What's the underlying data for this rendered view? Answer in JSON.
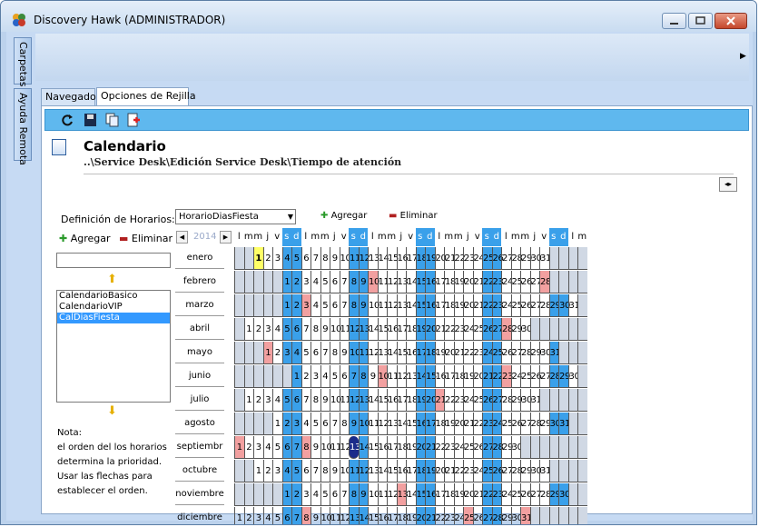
{
  "window": {
    "title": "Discovery Hawk (ADMINISTRADOR)"
  },
  "vertical_tabs": [
    "Carpetas",
    "Ayuda Remota"
  ],
  "tabs": [
    "Navegador",
    "Opciones de Rejilla"
  ],
  "toolbar": {
    "icons": [
      "refresh-icon",
      "save-icon",
      "copy-icon",
      "new-document-icon"
    ]
  },
  "header": {
    "title": "Calendario",
    "breadcrumb": "..\\Service Desk\\Edición Service Desk\\Tiempo de atención"
  },
  "left": {
    "definition_label": "Definición de Horarios:",
    "add_label": "Agregar",
    "delete_label": "Eliminar",
    "input_value": "",
    "items": [
      "CalendarioBasico",
      "CalendarioVIP",
      "CalDiasFiesta"
    ],
    "selected_index": 2,
    "note": [
      "Nota:",
      "el orden del los horarios",
      "determina la prioridad.",
      "Usar las flechas para",
      "establecer el orden."
    ]
  },
  "grid": {
    "combo_value": "HorarioDiasFiesta",
    "add_label": "Agregar",
    "delete_label": "Eliminar",
    "year": "2014",
    "weekday_headers": [
      "l",
      "m",
      "m",
      "j",
      "v",
      "s",
      "d",
      "l",
      "m",
      "m",
      "j",
      "v",
      "s",
      "d",
      "l",
      "m",
      "m",
      "j",
      "v",
      "s",
      "d",
      "l",
      "m",
      "m",
      "j",
      "v",
      "s",
      "d",
      "l",
      "m",
      "m",
      "j",
      "v",
      "s",
      "d",
      "l",
      "m"
    ],
    "months": [
      {
        "name": "enero",
        "offset": 2,
        "days": 31,
        "holidays": [],
        "today": 1
      },
      {
        "name": "febrero",
        "offset": 5,
        "days": 28,
        "holidays": [
          10,
          28
        ]
      },
      {
        "name": "marzo",
        "offset": 5,
        "days": 31,
        "holidays": [
          3
        ]
      },
      {
        "name": "abril",
        "offset": 1,
        "days": 30,
        "holidays": [
          28
        ]
      },
      {
        "name": "mayo",
        "offset": 3,
        "days": 31,
        "holidays": [
          1
        ]
      },
      {
        "name": "junio",
        "offset": 6,
        "days": 30,
        "holidays": [
          10,
          23
        ]
      },
      {
        "name": "julio",
        "offset": 1,
        "days": 31,
        "holidays": [
          21
        ]
      },
      {
        "name": "agosto",
        "offset": 4,
        "days": 31,
        "holidays": []
      },
      {
        "name": "septiembr",
        "offset": 0,
        "days": 30,
        "holidays": [
          1,
          8
        ],
        "selected": 13
      },
      {
        "name": "octubre",
        "offset": 2,
        "days": 31,
        "holidays": []
      },
      {
        "name": "noviembre",
        "offset": 5,
        "days": 30,
        "holidays": [
          13
        ]
      },
      {
        "name": "diciembre",
        "offset": 0,
        "days": 31,
        "holidays": [
          8,
          25,
          31
        ]
      }
    ]
  },
  "colors": {
    "weekend": "#3aa0ea",
    "holiday": "#f2a0a0",
    "today": "#ffff66",
    "selected": "#1a2b8a",
    "empty": "#d0d8e4"
  }
}
